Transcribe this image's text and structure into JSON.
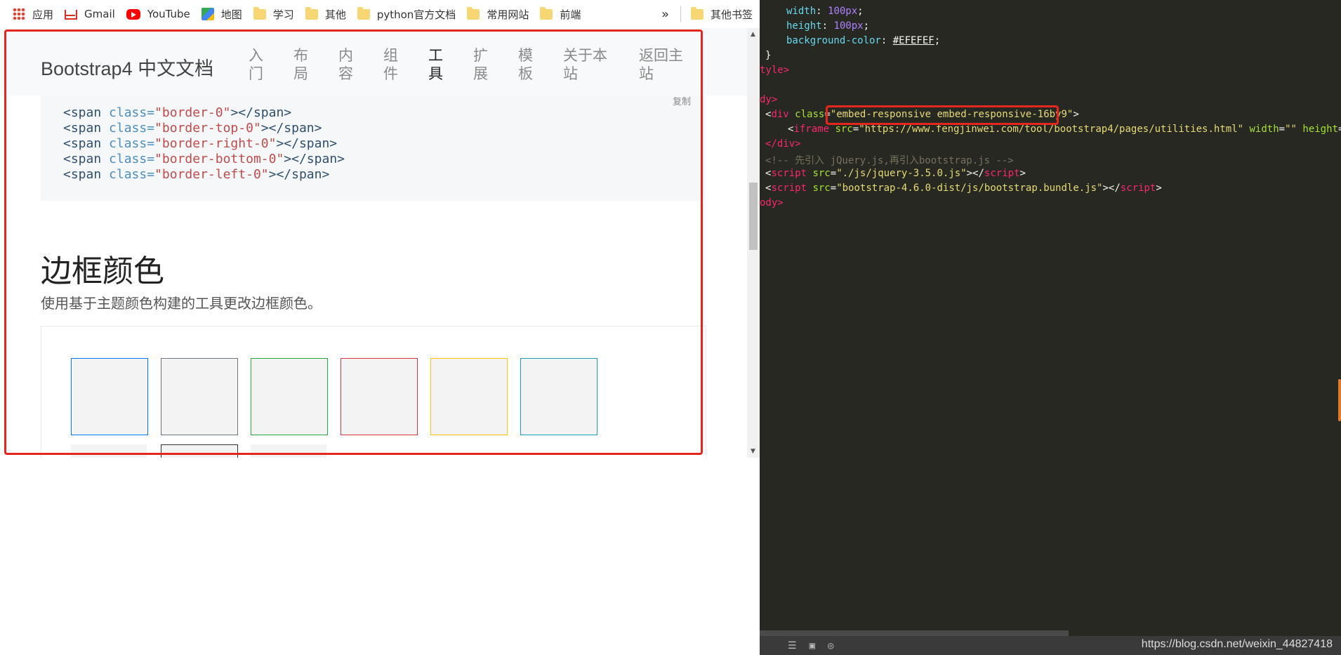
{
  "bookmarks": {
    "items": [
      {
        "label": "应用",
        "icon": "apps-grid-icon"
      },
      {
        "label": "Gmail",
        "icon": "gmail-icon"
      },
      {
        "label": "YouTube",
        "icon": "youtube-icon"
      },
      {
        "label": "地图",
        "icon": "maps-icon"
      },
      {
        "label": "学习",
        "icon": "folder-icon"
      },
      {
        "label": "其他",
        "icon": "folder-icon"
      },
      {
        "label": "python官方文档",
        "icon": "folder-icon"
      },
      {
        "label": "常用网站",
        "icon": "folder-icon"
      },
      {
        "label": "前端",
        "icon": "folder-icon"
      }
    ],
    "more": "»",
    "other_bookmarks": "其他书签"
  },
  "embedded_page": {
    "brand": "Bootstrap4 中文文档",
    "nav": [
      "入门",
      "布局",
      "内容",
      "组件",
      "工具",
      "扩展",
      "模板",
      "关于本站",
      "返回主站"
    ],
    "active_nav": "工具",
    "copy_label": "复制",
    "code_lines": [
      {
        "open": "<span ",
        "attr": "class=",
        "value": "\"border-0\"",
        "close": "></span>"
      },
      {
        "open": "<span ",
        "attr": "class=",
        "value": "\"border-top-0\"",
        "close": "></span>"
      },
      {
        "open": "<span ",
        "attr": "class=",
        "value": "\"border-right-0\"",
        "close": "></span>"
      },
      {
        "open": "<span ",
        "attr": "class=",
        "value": "\"border-bottom-0\"",
        "close": "></span>"
      },
      {
        "open": "<span ",
        "attr": "class=",
        "value": "\"border-left-0\"",
        "close": "></span>"
      }
    ],
    "section_title": "边框颜色",
    "section_desc": "使用基于主题颜色构建的工具更改边框颜色。",
    "swatch_colors": [
      "#007bff",
      "#6c757d",
      "#28a745",
      "#dc3545",
      "#ffc107",
      "#17a2b8"
    ],
    "highlight_color": "#e5261e"
  },
  "editor": {
    "lines": {
      "l1_prop": "width",
      "l1_val": "100px",
      "l2_prop": "height",
      "l2_val": "100px",
      "l3_prop": "background-color",
      "l3_val": "#EFEFEF",
      "l4": "}",
      "l5": "tyle>",
      "l6": "dy>",
      "l7_tag": "div",
      "l7_attr": "class",
      "l7_val": "\"embed-responsive embed-responsive-16by9\"",
      "l8_tag": "iframe",
      "l8_attr": "src",
      "l8_val": "\"https://www.fengjinwei.com/tool/bootstrap4/pages/utilities.html\"",
      "l8_attr2": "width",
      "l8_val2": "\"\"",
      "l8_attr3": "height",
      "l8_val3": "\"\"",
      "l9": "</div>",
      "l10": "<!-- 先引入 jQuery.js,再引入bootstrap.js -->",
      "l11_val": "\"./js/jquery-3.5.0.js\"",
      "l12_val": "\"bootstrap-4.6.0-dist/js/bootstrap.bundle.js\"",
      "l13": "ody>"
    },
    "watermark": "https://blog.csdn.net/weixin_44827418"
  }
}
